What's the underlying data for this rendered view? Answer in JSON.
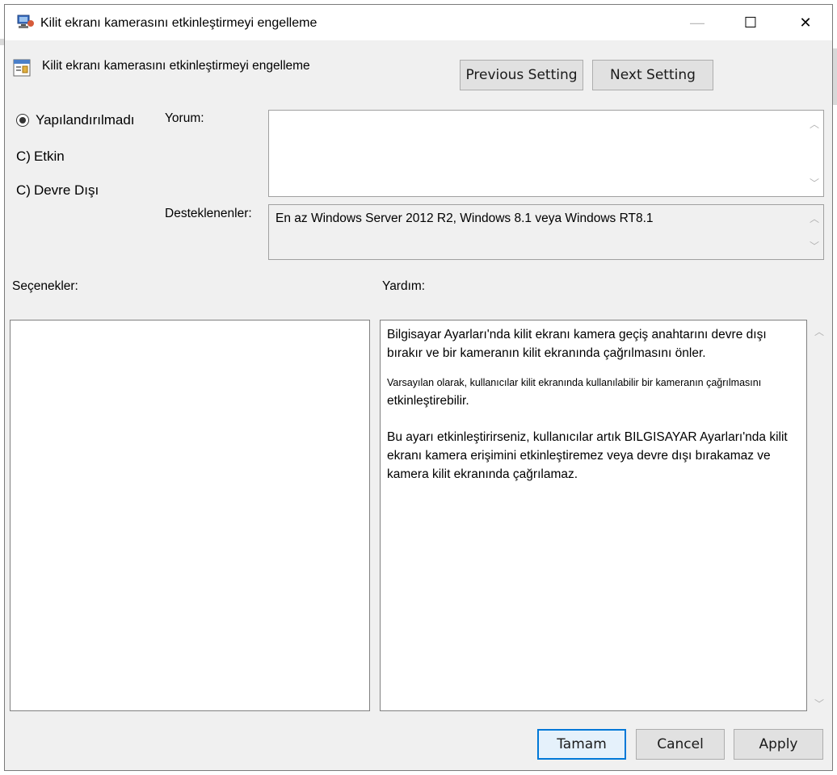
{
  "window": {
    "title": "Kilit ekranı kamerasını etkinleştirmeyi engelleme",
    "minimize_glyph": "—",
    "maximize_glyph": "☐",
    "close_glyph": "✕"
  },
  "header": {
    "policy_title": "Kilit ekranı kamerasını etkinleştirmeyi engelleme",
    "previous_label": "Previous Setting",
    "next_label": "Next Setting"
  },
  "state": {
    "options": [
      {
        "label": "Yapılandırılmadı",
        "prefix": "",
        "selected": true
      },
      {
        "label": "Etkin",
        "prefix": "C)",
        "selected": false
      },
      {
        "label": "Devre Dışı",
        "prefix": "C)",
        "selected": false
      }
    ]
  },
  "comment": {
    "label": "Yorum:",
    "value": ""
  },
  "supported": {
    "label": "Desteklenenler:",
    "value": "En az Windows Server 2012 R2, Windows 8.1 veya Windows RT8.1"
  },
  "options_section": {
    "label": "Seçenekler:"
  },
  "help_section": {
    "label": "Yardım:",
    "paragraphs": [
      "Bilgisayar Ayarları'nda kilit ekranı kamera geçiş anahtarını devre dışı bırakır ve bir kameranın kilit ekranında çağrılmasını önler.",
      "Varsayılan olarak, kullanıcılar kilit ekranında kullanılabilir bir kameranın çağrılmasını",
      "etkinleştirebilir.",
      "Bu ayarı etkinleştirirseniz, kullanıcılar artık BILGISAYAR Ayarları'nda kilit ekranı kamera erişimini etkinleştiremez veya devre dışı bırakamaz ve kamera kilit ekranında çağrılamaz."
    ]
  },
  "footer": {
    "ok_label": "Tamam",
    "cancel_label": "Cancel",
    "apply_label": "Apply"
  },
  "colors": {
    "dialog_bg": "#f0f0f0",
    "accent": "#0078d7",
    "button_bg": "#e1e1e1"
  },
  "icons": {
    "title_icon": "policy-computer-icon",
    "header_icon": "policy-setting-icon"
  }
}
